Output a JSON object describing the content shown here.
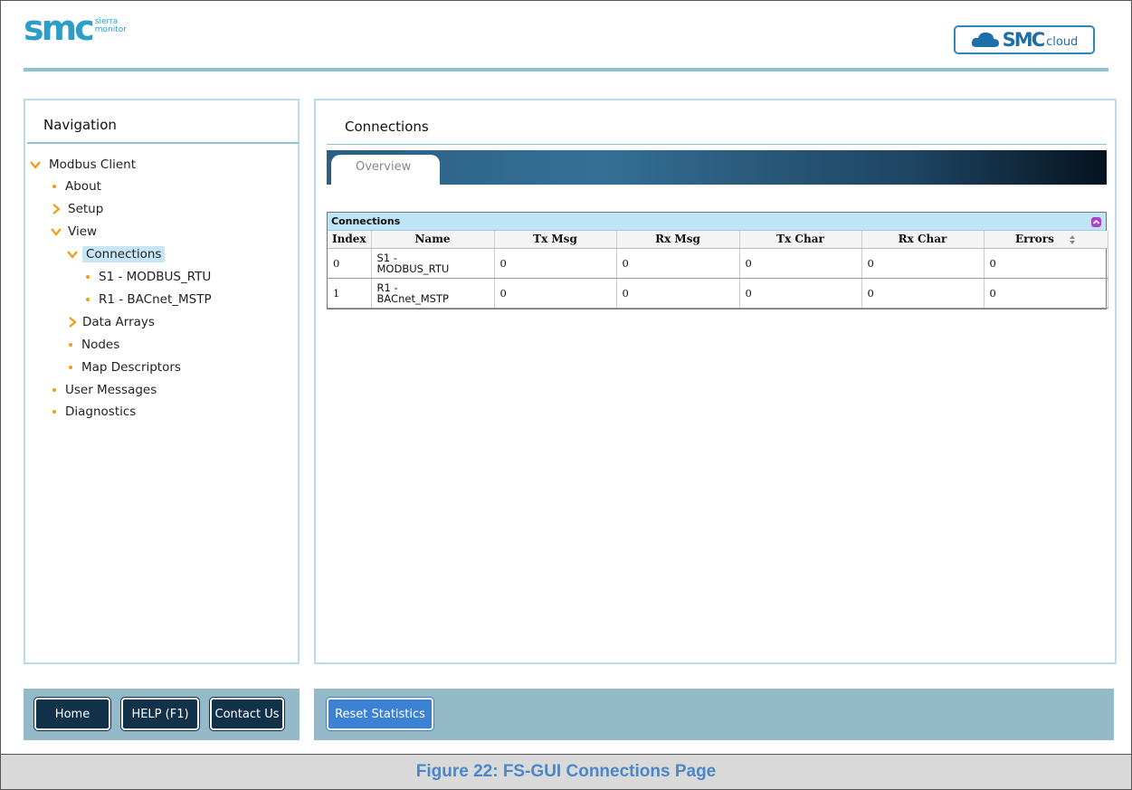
{
  "header": {
    "logo_text": "smc",
    "logo_sub_line1": "sierra",
    "logo_sub_line2": "monitor",
    "cloud_logo_smc": "SMC",
    "cloud_logo_word": "cloud",
    "accent_color": "#2e9ec9"
  },
  "nav": {
    "title": "Navigation",
    "items": [
      {
        "label": "Modbus Client",
        "icon": "chevron-down-icon"
      },
      {
        "label": "About",
        "icon": "bullet-icon"
      },
      {
        "label": "Setup",
        "icon": "chevron-right-icon"
      },
      {
        "label": "View",
        "icon": "chevron-down-icon"
      },
      {
        "label": "Connections",
        "icon": "chevron-down-icon",
        "selected": true
      },
      {
        "label": "S1 - MODBUS_RTU",
        "icon": "bullet-icon"
      },
      {
        "label": "R1 - BACnet_MSTP",
        "icon": "bullet-icon"
      },
      {
        "label": "Data Arrays",
        "icon": "chevron-right-icon"
      },
      {
        "label": "Nodes",
        "icon": "bullet-icon"
      },
      {
        "label": "Map Descriptors",
        "icon": "bullet-icon"
      },
      {
        "label": "User Messages",
        "icon": "bullet-icon"
      },
      {
        "label": "Diagnostics",
        "icon": "bullet-icon"
      }
    ]
  },
  "main": {
    "title": "Connections",
    "tabs": [
      {
        "label": "Overview",
        "active": true
      }
    ],
    "grid": {
      "caption": "Connections",
      "columns": [
        "Index",
        "Name",
        "Tx Msg",
        "Rx Msg",
        "Tx Char",
        "Rx Char",
        "Errors"
      ],
      "rows": [
        {
          "index": "0",
          "name_line1": "S1 -",
          "name_line2": "MODBUS_RTU",
          "tx_msg": "0",
          "rx_msg": "0",
          "tx_char": "0",
          "rx_char": "0",
          "errors": "0"
        },
        {
          "index": "1",
          "name_line1": "R1 -",
          "name_line2": "BACnet_MSTP",
          "tx_msg": "0",
          "rx_msg": "0",
          "tx_char": "0",
          "rx_char": "0",
          "errors": "0"
        }
      ]
    }
  },
  "footer": {
    "home_label": "Home",
    "help_label": "HELP (F1)",
    "contact_label": "Contact Us",
    "reset_label": "Reset Statistics"
  },
  "figure_caption": "Figure 22: FS-GUI Connections Page",
  "colors": {
    "chevron": "#f39c12",
    "panel_border": "#b7dcea",
    "footer_bg": "#94b9c8",
    "dark_button": "#12314a",
    "blue_button": "#3b82d4",
    "caption_text": "#4a86c8"
  }
}
